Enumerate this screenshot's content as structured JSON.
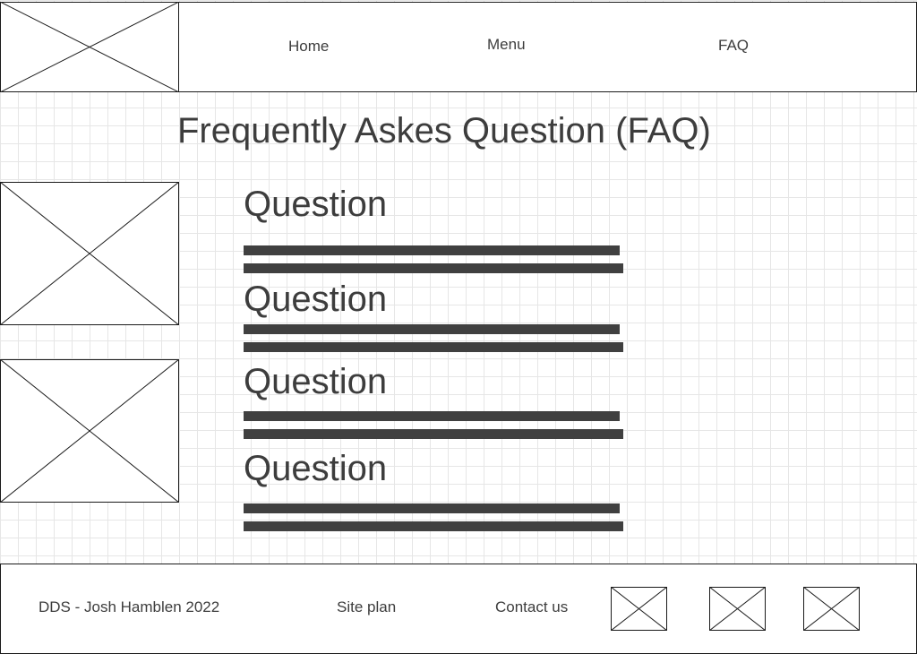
{
  "header": {
    "nav": [
      {
        "label": "Home"
      },
      {
        "label": "Menu"
      },
      {
        "label": "FAQ"
      }
    ]
  },
  "main": {
    "title": "Frequently Askes Question (FAQ)",
    "questions": [
      {
        "label": "Question"
      },
      {
        "label": "Question"
      },
      {
        "label": "Question"
      },
      {
        "label": "Question"
      }
    ]
  },
  "footer": {
    "copyright": "DDS - Josh Hamblen 2022",
    "site_plan": "Site plan",
    "contact": "Contact us"
  }
}
